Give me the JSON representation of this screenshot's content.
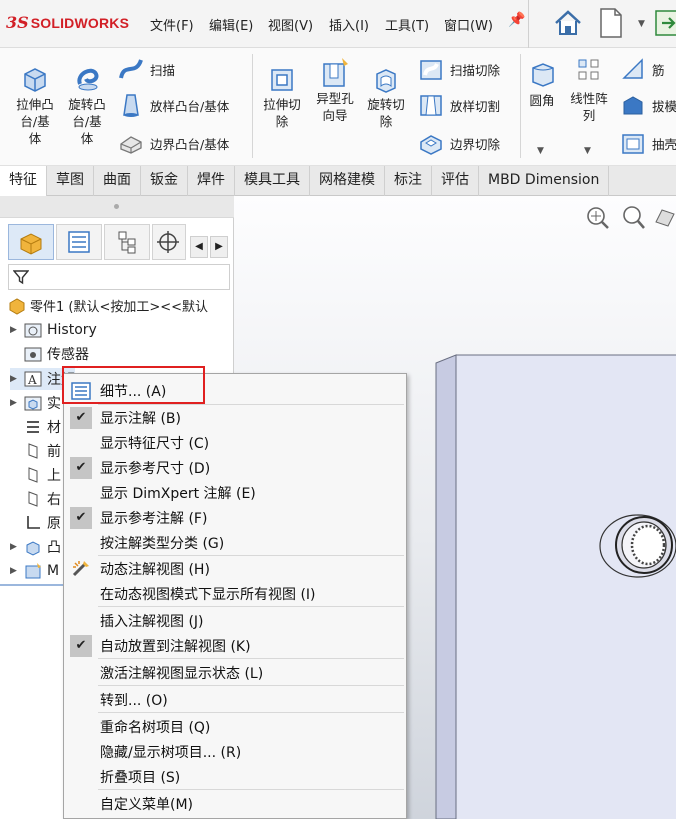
{
  "app": {
    "logo_ds": "3S",
    "logo_text": "SOLIDWORKS",
    "menu": [
      "文件(F)",
      "编辑(E)",
      "视图(V)",
      "插入(I)",
      "工具(T)",
      "窗口(W)"
    ]
  },
  "ribbon": {
    "extrude_boss": "拉伸凸\n台/基\n体",
    "revolve_boss": "旋转凸\n台/基\n体",
    "sweep": "扫描",
    "loft_boss": "放样凸台/基体",
    "boundary_boss": "边界凸台/基体",
    "extrude_cut": "拉伸切\n除",
    "hole_wizard": "异型孔\n向导",
    "revolve_cut": "旋转切\n除",
    "swept_cut": "扫描切除",
    "lofted_cut": "放样切割",
    "boundary_cut": "边界切除",
    "fillet": "圆角",
    "linear_pattern": "线性阵\n列",
    "rib": "筋",
    "draft": "拔模",
    "shell": "抽壳"
  },
  "tabs": [
    "特征",
    "草图",
    "曲面",
    "钣金",
    "焊件",
    "模具工具",
    "网格建模",
    "标注",
    "评估",
    "MBD Dimension"
  ],
  "active_tab": "特征",
  "tree": {
    "root": "零件1 (默认<按加工><<默认",
    "items": [
      {
        "label": "History",
        "arrow": true
      },
      {
        "label": "传感器",
        "arrow": false
      },
      {
        "label": "注解",
        "arrow": true
      },
      {
        "label": "实",
        "arrow": true
      },
      {
        "label": "材",
        "arrow": false
      },
      {
        "label": "前",
        "arrow": false
      },
      {
        "label": "上",
        "arrow": false
      },
      {
        "label": "右",
        "arrow": false
      },
      {
        "label": "原",
        "arrow": false
      },
      {
        "label": "凸",
        "arrow": true
      },
      {
        "label": "M",
        "arrow": true
      }
    ]
  },
  "context_menu": {
    "items": [
      {
        "label": "细节... (A)",
        "checked": false,
        "icon": "details-icon"
      },
      {
        "label": "显示注解 (B)",
        "checked": true
      },
      {
        "label": "显示特征尺寸 (C)",
        "checked": false
      },
      {
        "label": "显示参考尺寸 (D)",
        "checked": true
      },
      {
        "label": "显示 DimXpert 注解 (E)",
        "checked": false
      },
      {
        "label": "显示参考注解 (F)",
        "checked": true
      },
      {
        "label": "按注解类型分类 (G)",
        "checked": false
      },
      {
        "label": "动态注解视图 (H)",
        "checked": false,
        "icon": "dynamic-view-icon"
      },
      {
        "label": "在动态视图模式下显示所有视图 (I)",
        "checked": false
      },
      {
        "label": "插入注解视图 (J)",
        "checked": false
      },
      {
        "label": "自动放置到注解视图 (K)",
        "checked": true
      },
      {
        "label": "激活注解视图显示状态 (L)",
        "checked": false
      },
      {
        "label": "转到... (O)",
        "checked": false
      },
      {
        "label": "重命名树项目 (Q)",
        "checked": false
      },
      {
        "label": "隐藏/显示树项目... (R)",
        "checked": false
      },
      {
        "label": "折叠项目 (S)",
        "checked": false
      },
      {
        "label": "自定义菜单(M)",
        "checked": false
      }
    ],
    "check_glyph": "✔"
  },
  "colors": {
    "brand_red": "#d21f26",
    "highlight_red": "#e02020",
    "icon_blue": "#3b78c4",
    "folder_yellow": "#f0b43c"
  }
}
